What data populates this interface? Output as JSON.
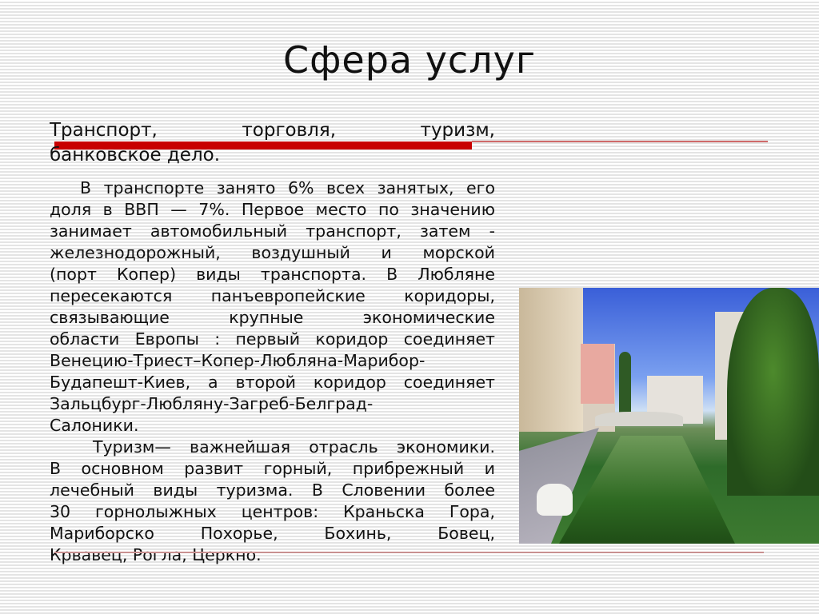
{
  "slide": {
    "title": "Сфера услуг",
    "lead_lines": [
      "Транспорт, торговля, туризм,",
      "банковское дело."
    ],
    "paragraph1_lines": [
      "В транспорте занято 6% всех занятых, его",
      "доля в ВВП — 7%. Первое место по значению",
      "занимает автомобильный транспорт, затем -",
      "железнодорожный, воздушный и морской",
      "(порт Копер) виды транспорта. В Любляне",
      "пересекаются панъевропейские коридоры,",
      "связывающие крупные экономические",
      "области Европы : первый коридор соединяет",
      "Венецию-Триест–Копер-Любляна-Марибор-",
      "Будапешт-Киев, а второй коридор соединяет",
      "Зальцбург-Любляну-Загреб-Белград-",
      "Салоники."
    ],
    "paragraph2_lines": [
      "Туризм— важнейшая отрасль экономики.",
      "В основном развит горный, прибрежный и",
      "лечебный виды туризма. В Словении более",
      "30 горнолыжных центров: Краньска Гора,",
      "Мариборско Похорье, Бохинь, Бовец,",
      "Крвавец, Рогла, Церкно."
    ],
    "colors": {
      "accent_bar": "#c80000",
      "accent_line": "#d06a6a"
    },
    "image": "photo-ljubljana-canal"
  }
}
